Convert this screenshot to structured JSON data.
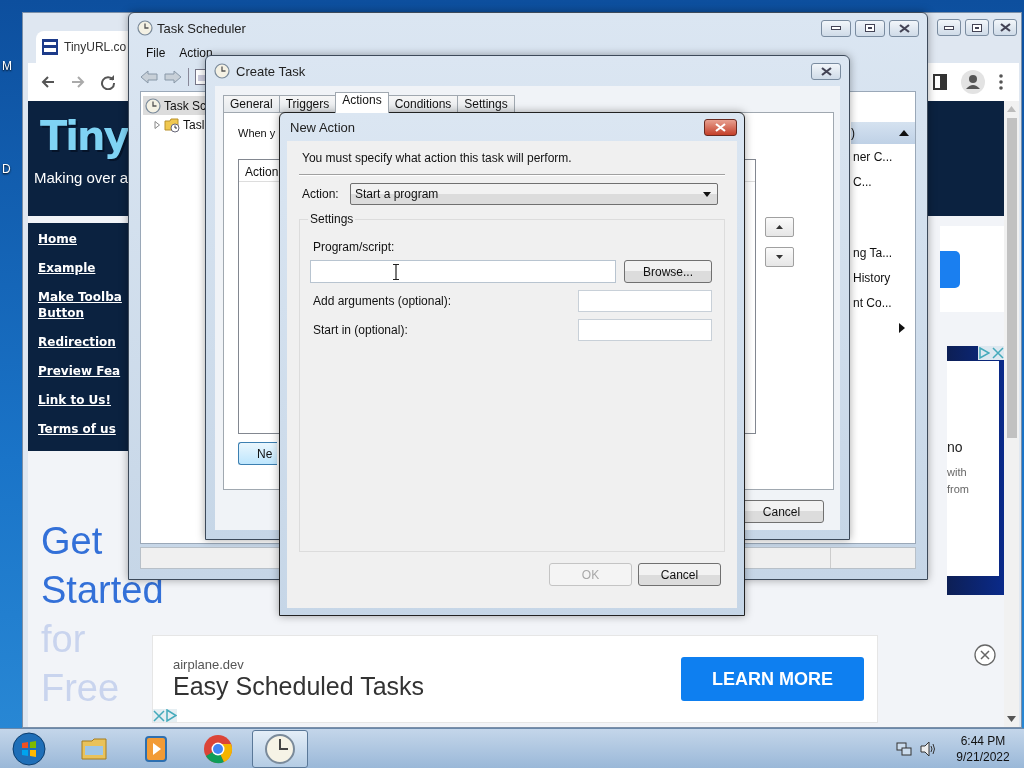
{
  "desktop": {
    "icon_labels": [
      "M",
      "D"
    ]
  },
  "browser": {
    "tab_title": "TinyURL.co",
    "page": {
      "logo": "Tiny",
      "tagline": "Making over a",
      "nav_links": [
        "Home",
        "Example",
        "Make Toolba\nButton",
        "Redirection",
        "Preview Fea",
        "Link to Us!",
        "Terms of us"
      ],
      "promo_lines": [
        {
          "text": "Get",
          "faded": false
        },
        {
          "text": "Started",
          "faded": false
        },
        {
          "text": "for",
          "faded": true
        },
        {
          "text": "Free",
          "faded": true
        }
      ],
      "side_ad_lines": [
        "no",
        "with",
        "from"
      ],
      "bottom_ad": {
        "domain": "airplane.dev",
        "headline": "Easy Scheduled Tasks",
        "button": "LEARN MORE"
      }
    }
  },
  "task_scheduler": {
    "title": "Task Scheduler",
    "menu": [
      "File",
      "Action"
    ],
    "tree": [
      {
        "label": "Task Sc",
        "selected": true,
        "children": [
          {
            "label": "Tasl",
            "expanded": false,
            "selected": false
          }
        ]
      }
    ],
    "actions_pane": {
      "header": ")",
      "expanded": true,
      "items": [
        {
          "kind": "action",
          "label": "ner C..."
        },
        {
          "kind": "action",
          "label": "C..."
        },
        {
          "kind": "action",
          "label": "ng Ta..."
        },
        {
          "kind": "action",
          "label": "History"
        },
        {
          "kind": "action",
          "label": "nt Co..."
        },
        {
          "kind": "submenu"
        }
      ]
    }
  },
  "create_task": {
    "title": "Create Task",
    "tabs": [
      {
        "label": "General",
        "selected": false
      },
      {
        "label": "Triggers",
        "selected": false
      },
      {
        "label": "Actions",
        "selected": true
      },
      {
        "label": "Conditions",
        "selected": false
      },
      {
        "label": "Settings",
        "selected": false
      }
    ],
    "intro": "When y",
    "list_header": "Action",
    "new_button": "Ne",
    "cancel_button": "Cancel"
  },
  "new_action": {
    "title": "New Action",
    "instruction": "You must specify what action this task will perform.",
    "action_label": "Action:",
    "action_value": "Start a program",
    "group_label": "Settings",
    "program_label": "Program/script:",
    "browse_button": "Browse...",
    "optional_fields": [
      {
        "label": "Add arguments (optional):"
      },
      {
        "label": "Start in (optional):"
      }
    ],
    "buttons": [
      {
        "label": "OK",
        "disabled": true
      },
      {
        "label": "Cancel",
        "disabled": false
      }
    ]
  },
  "taskbar": {
    "apps": [
      {
        "kind": "explorer",
        "active": false
      },
      {
        "kind": "media",
        "active": false
      },
      {
        "kind": "chrome",
        "active": false
      },
      {
        "kind": "scheduler",
        "active": true
      }
    ],
    "clock": {
      "time": "6:44 PM",
      "date": "9/21/2022"
    }
  }
}
